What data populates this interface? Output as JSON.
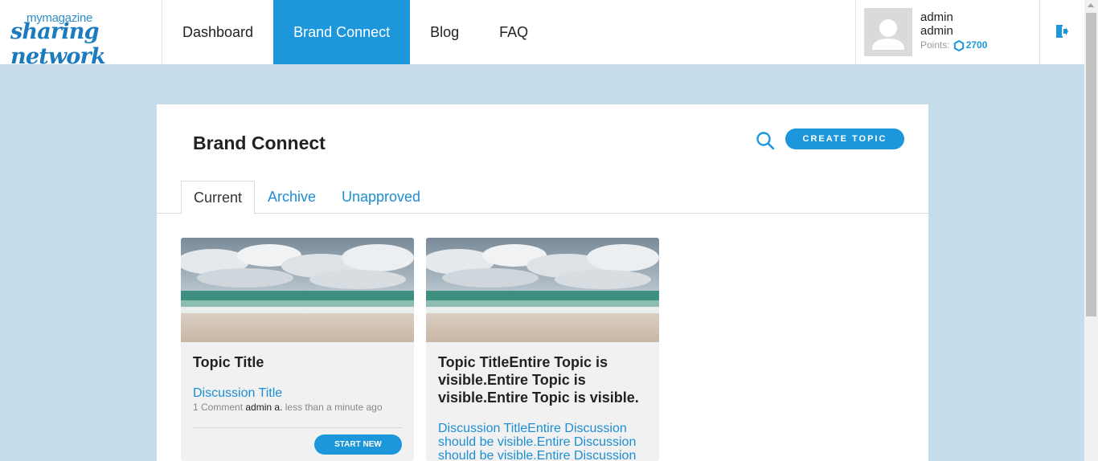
{
  "header": {
    "logo_small": "mymagazine",
    "logo_big": "sharing network",
    "nav": [
      {
        "label": "Dashboard"
      },
      {
        "label": "Brand Connect",
        "active": true
      },
      {
        "label": "Blog"
      },
      {
        "label": "FAQ"
      }
    ],
    "user": {
      "first_name": "admin",
      "last_name": "admin",
      "points_label": "Points:",
      "points_value": "2700"
    },
    "logout_icon": "logout-icon"
  },
  "page": {
    "title": "Brand Connect",
    "search_icon": "search-icon",
    "create_topic_label": "CREATE TOPIC",
    "tabs": [
      {
        "label": "Current",
        "active": true
      },
      {
        "label": "Archive"
      },
      {
        "label": "Unapproved"
      }
    ]
  },
  "cards": [
    {
      "image": "beach-photo",
      "title": "Topic Title",
      "discussion": "Discussion Title",
      "comments": "1 Comment",
      "author": "admin a.",
      "time": "less than a minute ago",
      "button": "START NEW"
    },
    {
      "image": "beach-photo",
      "title": "Topic TitleEntire Topic is visible.Entire Topic is visible.Entire Topic is visible.",
      "discussion": "Discussion TitleEntire Discussion should be visible.Entire Discussion should be visible.Entire Discussion"
    }
  ],
  "colors": {
    "accent": "#1c97db",
    "background": "#c5dcea",
    "card": "#f1f1f1"
  }
}
